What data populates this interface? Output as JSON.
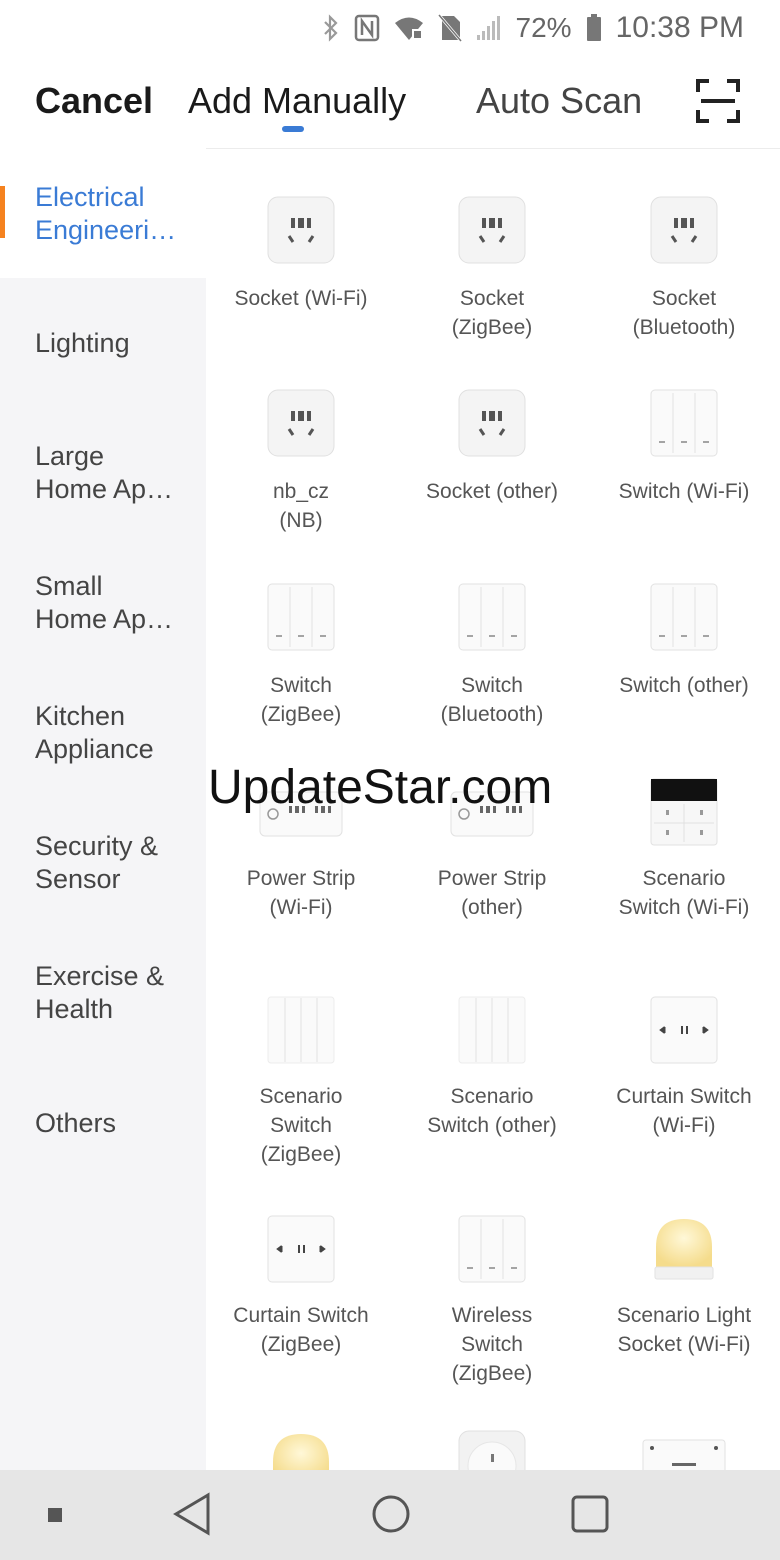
{
  "status_bar": {
    "battery": "72%",
    "time": "10:38 PM",
    "icons": [
      "bluetooth-icon",
      "nfc-icon",
      "wifi-icon",
      "no-sim-icon",
      "signal-icon",
      "battery-icon"
    ]
  },
  "header": {
    "cancel_label": "Cancel",
    "tabs": [
      {
        "label": "Add Manually",
        "active": true
      },
      {
        "label": "Auto Scan",
        "active": false
      }
    ],
    "scan_icon": "scan-icon",
    "accent_color": "#3a7bd5"
  },
  "sidebar": {
    "active_indicator_color": "#f5821f",
    "items": [
      {
        "label": "Electrical\nEngineeri…",
        "active": true
      },
      {
        "label": "Lighting",
        "active": false
      },
      {
        "label": "Large\nHome Ap…",
        "active": false
      },
      {
        "label": "Small\nHome Ap…",
        "active": false
      },
      {
        "label": "Kitchen\nAppliance",
        "active": false
      },
      {
        "label": "Security &\nSensor",
        "active": false
      },
      {
        "label": "Exercise &\nHealth",
        "active": false
      },
      {
        "label": "Others",
        "active": false
      }
    ]
  },
  "devices": [
    {
      "label": "Socket (Wi-Fi)",
      "icon": "socket-icon"
    },
    {
      "label": "Socket\n(ZigBee)",
      "icon": "socket-icon"
    },
    {
      "label": "Socket\n(Bluetooth)",
      "icon": "socket-icon"
    },
    {
      "label": "nb_cz\n(NB)",
      "icon": "socket-icon"
    },
    {
      "label": "Socket (other)",
      "icon": "socket-icon"
    },
    {
      "label": "Switch (Wi-Fi)",
      "icon": "wall-switch-icon"
    },
    {
      "label": "Switch\n(ZigBee)",
      "icon": "wall-switch-icon"
    },
    {
      "label": "Switch\n(Bluetooth)",
      "icon": "wall-switch-icon"
    },
    {
      "label": "Switch (other)",
      "icon": "wall-switch-icon"
    },
    {
      "label": "Power Strip\n(Wi-Fi)",
      "icon": "power-strip-icon"
    },
    {
      "label": "Power Strip\n(other)",
      "icon": "power-strip-icon"
    },
    {
      "label": "Scenario\nSwitch (Wi-Fi)",
      "icon": "scenario-panel-icon"
    },
    {
      "label": "Scenario\nSwitch\n(ZigBee)",
      "icon": "scenario-switch-icon"
    },
    {
      "label": "Scenario\nSwitch (other)",
      "icon": "scenario-switch-icon"
    },
    {
      "label": "Curtain Switch\n(Wi-Fi)",
      "icon": "curtain-switch-icon"
    },
    {
      "label": "Curtain Switch\n(ZigBee)",
      "icon": "curtain-switch-icon"
    },
    {
      "label": "Wireless\nSwitch\n(ZigBee)",
      "icon": "wall-switch-icon"
    },
    {
      "label": "Scenario Light\nSocket (Wi-Fi)",
      "icon": "lamp-icon"
    },
    {
      "label": "",
      "icon": "lamp-icon"
    },
    {
      "label": "",
      "icon": "round-plug-icon"
    },
    {
      "label": "",
      "icon": "on-off-panel-icon"
    }
  ],
  "watermark": "UpdateStar.com",
  "nav_bar": {
    "buttons": [
      "menu-dot-icon",
      "back-icon",
      "home-icon",
      "recents-icon"
    ]
  }
}
